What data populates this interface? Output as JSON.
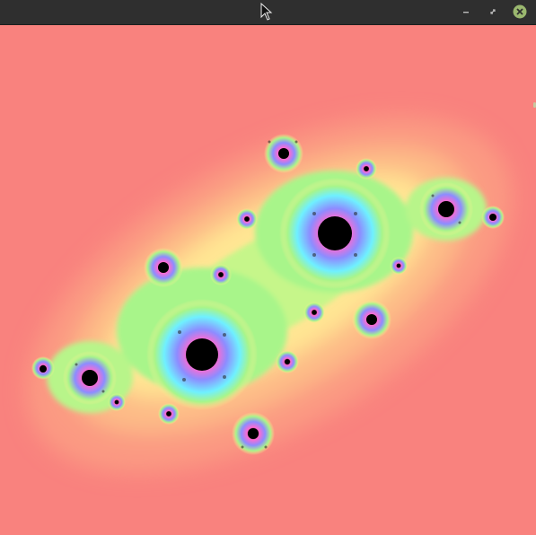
{
  "window": {
    "title": "",
    "controls": {
      "minimize_icon": "minimize-icon",
      "restore_icon": "restore-icon",
      "close_icon": "close-icon"
    }
  },
  "fractal": {
    "type": "julia-set",
    "colors": {
      "background": "#f9827e",
      "glow_outer": "#fb9f80",
      "glow_mid": "#fff090",
      "green": "#a8f58a",
      "cyan": "#6ff0ff",
      "blue": "#8d8cff",
      "pink": "#ff7ad0",
      "core": "#000000"
    }
  }
}
